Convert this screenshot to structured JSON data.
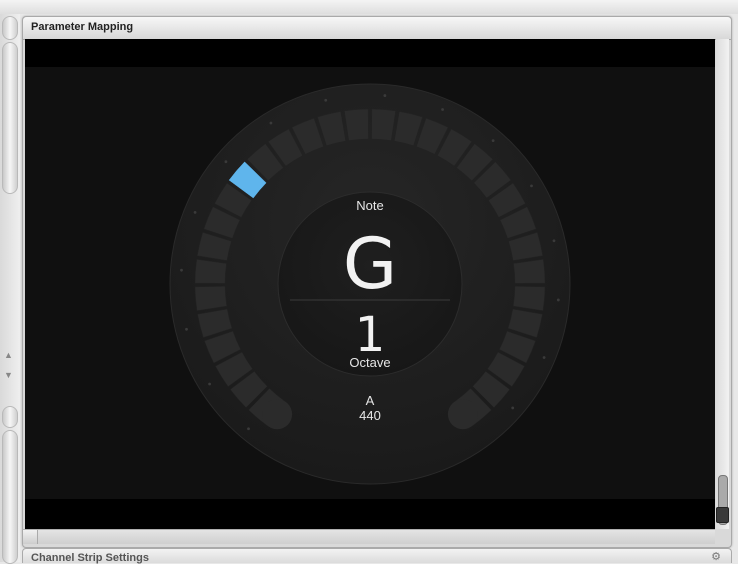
{
  "panel": {
    "title": "Parameter Mapping"
  },
  "tuner": {
    "note_label": "Note",
    "note_value": "G",
    "octave_value": "1",
    "octave_label": "Octave",
    "reference_note": "A",
    "reference_freq": "440",
    "selected_segment_index": 10,
    "accent_color": "#5fb5ec"
  },
  "next_panel": {
    "title": "Channel Strip Settings"
  },
  "icons": {
    "gear": "gear-icon"
  }
}
